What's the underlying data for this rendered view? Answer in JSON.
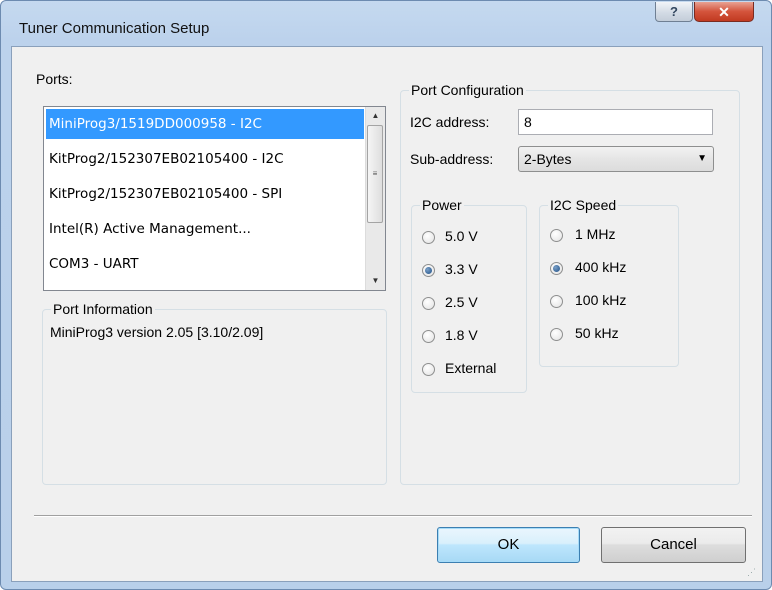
{
  "window": {
    "title": "Tuner Communication Setup",
    "help_glyph": "?",
    "close_glyph": "✕"
  },
  "ports": {
    "label": "Ports:",
    "items": [
      {
        "label": "MiniProg3/1519DD000958 - I2C",
        "selected": true
      },
      {
        "label": "KitProg2/152307EB02105400 - I2C",
        "selected": false
      },
      {
        "label": "KitProg2/152307EB02105400 - SPI",
        "selected": false
      },
      {
        "label": "Intel(R) Active Management...",
        "selected": false
      },
      {
        "label": "COM3 - UART",
        "selected": false
      }
    ]
  },
  "port_info": {
    "legend": "Port Information",
    "text": "MiniProg3 version 2.05 [3.10/2.09]"
  },
  "port_config": {
    "legend": "Port Configuration",
    "i2c_address_label": "I2C address:",
    "i2c_address_value": "8",
    "subaddress_label": "Sub-address:",
    "subaddress_value": "2-Bytes"
  },
  "power": {
    "legend": "Power",
    "options": [
      {
        "label": "5.0 V",
        "selected": false
      },
      {
        "label": "3.3 V",
        "selected": true
      },
      {
        "label": "2.5 V",
        "selected": false
      },
      {
        "label": "1.8 V",
        "selected": false
      },
      {
        "label": "External",
        "selected": false
      }
    ]
  },
  "i2c_speed": {
    "legend": "I2C Speed",
    "options": [
      {
        "label": "1 MHz",
        "selected": false
      },
      {
        "label": "400 kHz",
        "selected": true
      },
      {
        "label": "100 kHz",
        "selected": false
      },
      {
        "label": "50 kHz",
        "selected": false
      }
    ]
  },
  "buttons": {
    "ok": "OK",
    "cancel": "Cancel"
  },
  "colors": {
    "selection": "#3399ff",
    "title_bar": "#bcd2ec",
    "close_button": "#c13a21"
  }
}
